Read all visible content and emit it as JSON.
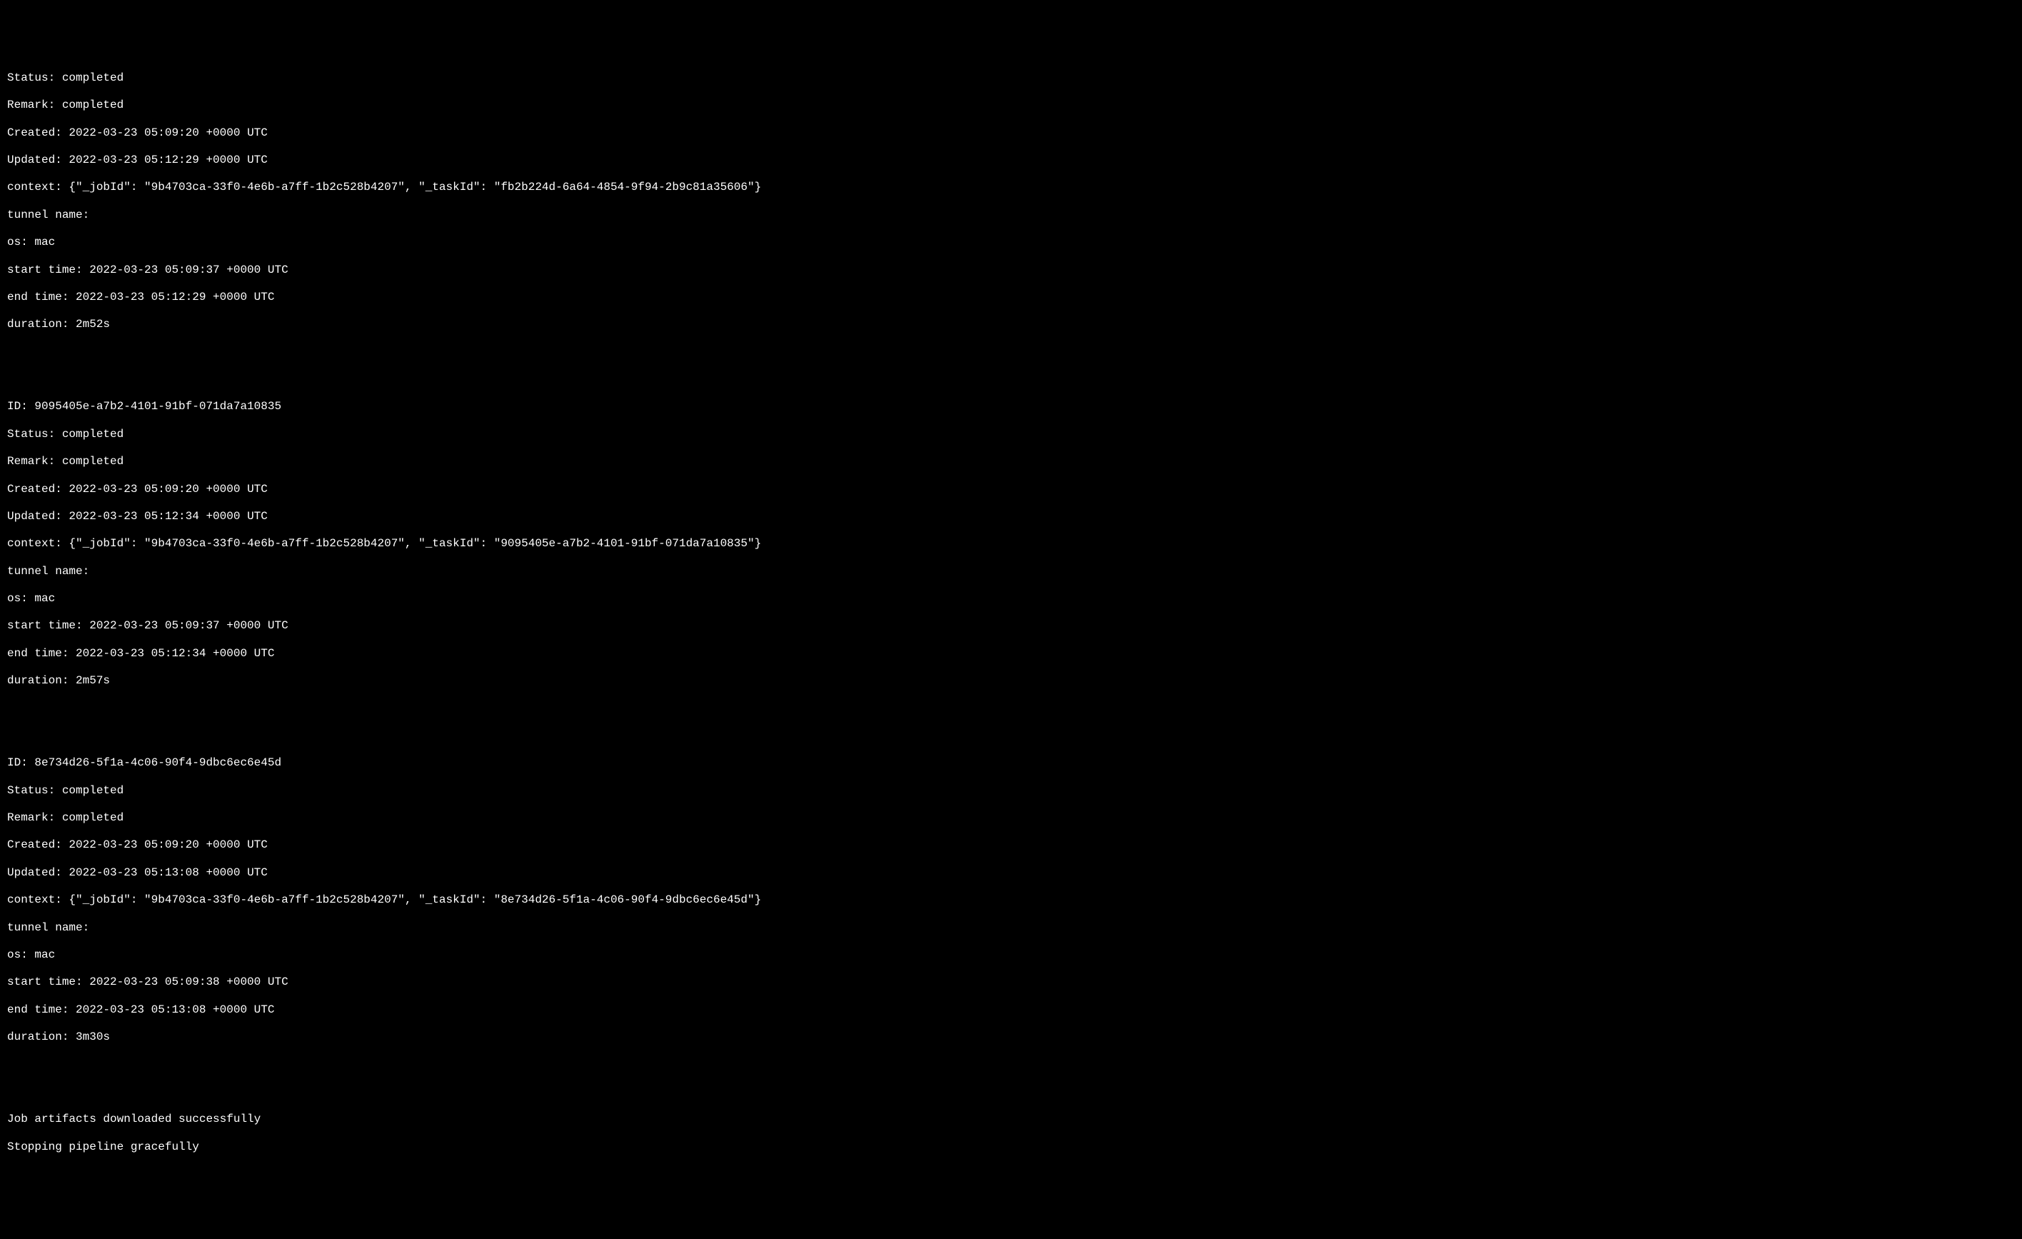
{
  "entries": [
    {
      "status": "completed",
      "remark": "completed",
      "created": "2022-03-23 05:09:20 +0000 UTC",
      "updated": "2022-03-23 05:12:29 +0000 UTC",
      "context": "{\"_jobId\": \"9b4703ca-33f0-4e6b-a7ff-1b2c528b4207\", \"_taskId\": \"fb2b224d-6a64-4854-9f94-2b9c81a35606\"}",
      "tunnel_name": "",
      "os": "mac",
      "start_time": "2022-03-23 05:09:37 +0000 UTC",
      "end_time": "2022-03-23 05:12:29 +0000 UTC",
      "duration": "2m52s"
    },
    {
      "id": "9095405e-a7b2-4101-91bf-071da7a10835",
      "status": "completed",
      "remark": "completed",
      "created": "2022-03-23 05:09:20 +0000 UTC",
      "updated": "2022-03-23 05:12:34 +0000 UTC",
      "context": "{\"_jobId\": \"9b4703ca-33f0-4e6b-a7ff-1b2c528b4207\", \"_taskId\": \"9095405e-a7b2-4101-91bf-071da7a10835\"}",
      "tunnel_name": "",
      "os": "mac",
      "start_time": "2022-03-23 05:09:37 +0000 UTC",
      "end_time": "2022-03-23 05:12:34 +0000 UTC",
      "duration": "2m57s"
    },
    {
      "id": "8e734d26-5f1a-4c06-90f4-9dbc6ec6e45d",
      "status": "completed",
      "remark": "completed",
      "created": "2022-03-23 05:09:20 +0000 UTC",
      "updated": "2022-03-23 05:13:08 +0000 UTC",
      "context": "{\"_jobId\": \"9b4703ca-33f0-4e6b-a7ff-1b2c528b4207\", \"_taskId\": \"8e734d26-5f1a-4c06-90f4-9dbc6ec6e45d\"}",
      "tunnel_name": "",
      "os": "mac",
      "start_time": "2022-03-23 05:09:38 +0000 UTC",
      "end_time": "2022-03-23 05:13:08 +0000 UTC",
      "duration": "3m30s"
    }
  ],
  "labels": {
    "id": "ID: ",
    "status": "Status: ",
    "remark": "Remark: ",
    "created": "Created: ",
    "updated": "Updated: ",
    "context": "context: ",
    "tunnel_name": "tunnel name:",
    "os": "os: ",
    "start_time": "start time: ",
    "end_time": "end time: ",
    "duration": "duration: "
  },
  "footer": {
    "artifacts": "Job artifacts downloaded successfully",
    "stopping": "Stopping pipeline gracefully"
  }
}
